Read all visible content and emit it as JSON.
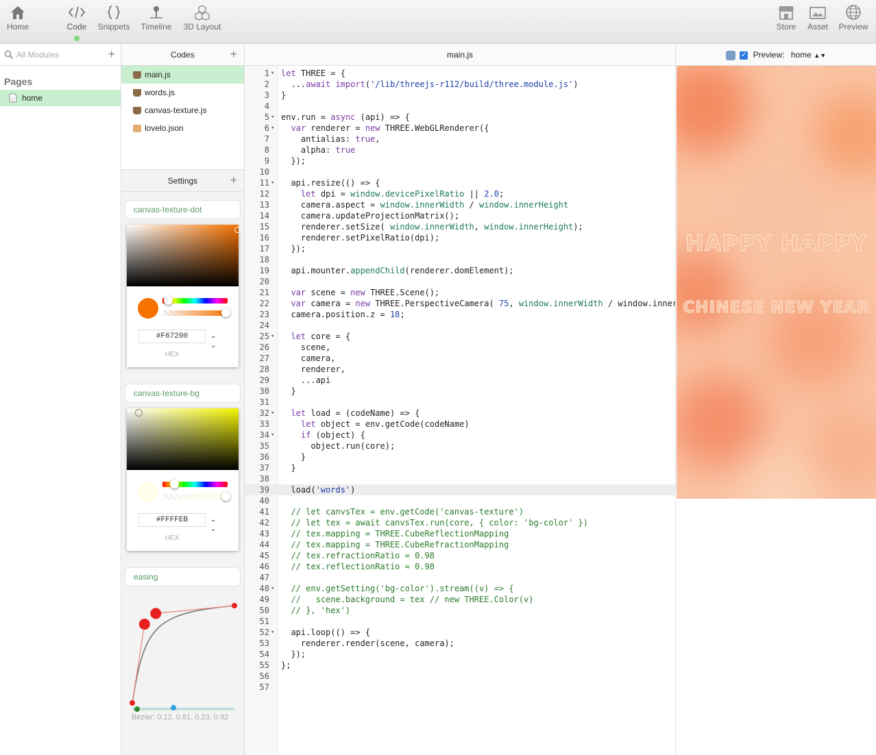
{
  "toolbar": {
    "left": [
      {
        "label": "Home",
        "icon": "home-icon"
      },
      {
        "label": "Code",
        "icon": "code-icon"
      },
      {
        "label": "Snippets",
        "icon": "braces-icon"
      },
      {
        "label": "Timeline",
        "icon": "timeline-icon"
      },
      {
        "label": "3D Layout",
        "icon": "cubes-icon"
      }
    ],
    "right": [
      {
        "label": "Store",
        "icon": "store-icon"
      },
      {
        "label": "Asset",
        "icon": "image-icon"
      },
      {
        "label": "Preview",
        "icon": "globe-icon"
      }
    ],
    "active": "Code",
    "active_indicator_color": "#7ed87e"
  },
  "modules": {
    "search_placeholder": "All Modules",
    "pages_title": "Pages",
    "pages": [
      {
        "label": "home"
      }
    ]
  },
  "codes": {
    "title": "Codes",
    "files": [
      {
        "label": "main.js",
        "icon": "coffee-icon",
        "active": true
      },
      {
        "label": "words.js",
        "icon": "coffee-icon"
      },
      {
        "label": "canvas-texture.js",
        "icon": "coffee-icon"
      },
      {
        "label": "lovelo.json",
        "icon": "box-icon"
      }
    ]
  },
  "settings": {
    "title": "Settings",
    "items": [
      {
        "label": "canvas-texture-dot",
        "hex": "#F67200",
        "format": "HEX",
        "hue_color": "#F67200",
        "hue": 0.04
      },
      {
        "label": "canvas-texture-bg",
        "hex": "#FFFFEB",
        "format": "HEX",
        "hue_color": "#F4F400",
        "hue": 0.12
      }
    ],
    "easing": {
      "label": "easing",
      "text": "Bezier: 0.12, 0.81, 0.23, 0.92",
      "values": [
        0.12,
        0.81,
        0.23,
        0.92
      ]
    }
  },
  "editor": {
    "filename": "main.js",
    "current_line": 39,
    "lines": [
      "let THREE = {",
      "  ...await import('/lib/threejs-r112/build/three.module.js')",
      "}",
      "",
      "env.run = async (api) => {",
      "  var renderer = new THREE.WebGLRenderer({",
      "    antialias: true,",
      "    alpha: true",
      "  });",
      "",
      "  api.resize(() => {",
      "    let dpi = window.devicePixelRatio || 2.0;",
      "    camera.aspect = window.innerWidth / window.innerHeight",
      "    camera.updateProjectionMatrix();",
      "    renderer.setSize( window.innerWidth, window.innerHeight);",
      "    renderer.setPixelRatio(dpi);",
      "  });",
      "",
      "  api.mounter.appendChild(renderer.domElement);",
      "",
      "  var scene = new THREE.Scene();",
      "  var camera = new THREE.PerspectiveCamera( 75, window.innerWidth / window.inner",
      "  camera.position.z = 18;",
      "",
      "  let core = {",
      "    scene,",
      "    camera,",
      "    renderer,",
      "    ...api",
      "  }",
      "",
      "  let load = (codeName) => {",
      "    let object = env.getCode(codeName)",
      "    if (object) {",
      "      object.run(core);",
      "    }",
      "  }",
      "",
      "  load('words')",
      "",
      "  // let canvsTex = env.getCode('canvas-texture')",
      "  // let tex = await canvsTex.run(core, { color: 'bg-color' })",
      "  // tex.mapping = THREE.CubeReflectionMapping",
      "  // tex.mapping = THREE.CubeRefractionMapping",
      "  // tex.refractionRatio = 0.98",
      "  // tex.reflectionRatio = 0.98",
      "",
      "  // env.getSetting('bg-color').stream((v) => {",
      "  //   scene.background = tex // new THREE.Color(v)",
      "  // }, 'hex')",
      "",
      "  api.loop(() => {",
      "    renderer.render(scene, camera);",
      "  });",
      "};",
      "",
      ""
    ],
    "fold_lines": [
      1,
      5,
      6,
      11,
      25,
      32,
      34,
      48,
      52
    ]
  },
  "preview": {
    "checkbox_checked": true,
    "label": "Preview:",
    "page": "home",
    "line1": "HAPPY HAPPY",
    "line2": "CHINESE NEW YEAR"
  }
}
